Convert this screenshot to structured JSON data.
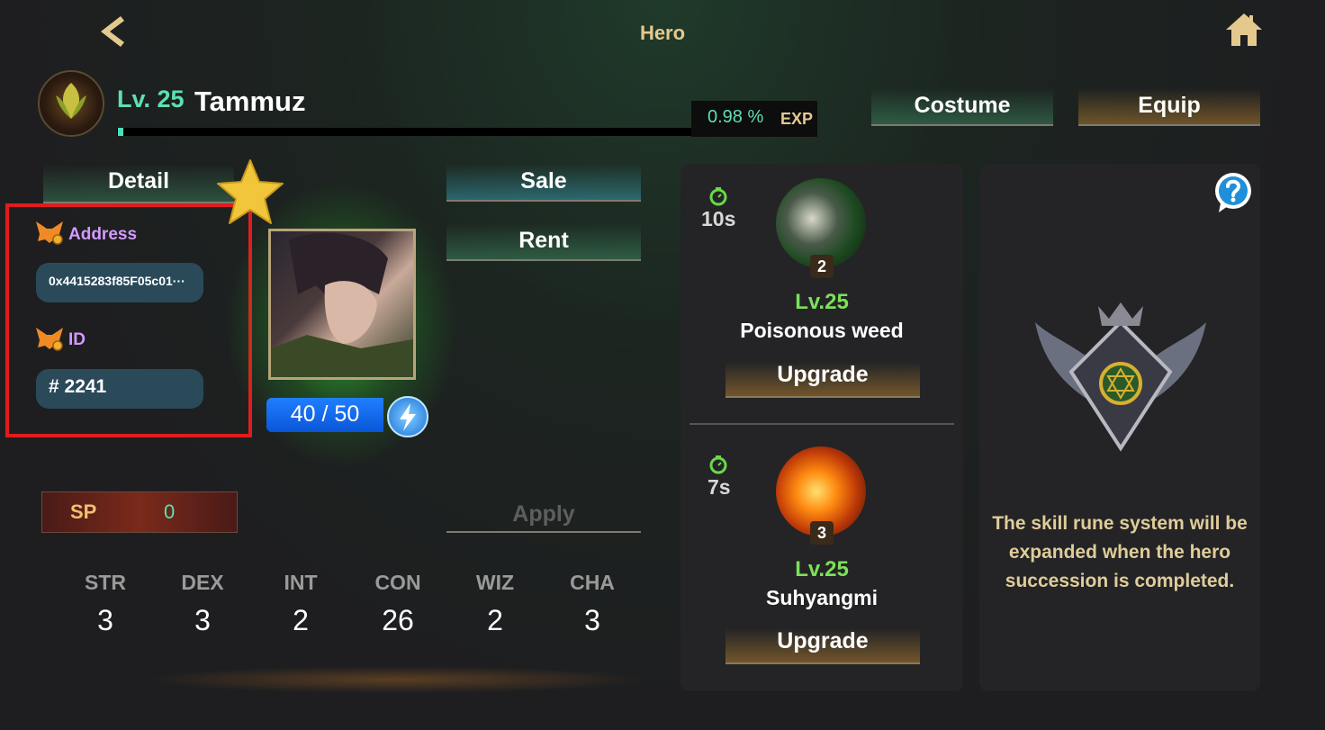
{
  "header": {
    "title": "Hero"
  },
  "hero": {
    "level": "Lv. 25",
    "name": "Tammuz",
    "exp_percent": "0.98 %",
    "exp_label": "EXP",
    "exp_fraction": 0.0098
  },
  "nav": {
    "costume_label": "Costume",
    "equip_label": "Equip",
    "detail_label": "Detail",
    "sale_label": "Sale",
    "rent_label": "Rent",
    "apply_label": "Apply"
  },
  "info": {
    "address_label": "Address",
    "address_value": "0x4415283f85F05c01···",
    "id_label": "ID",
    "id_value": "# 2241"
  },
  "stamina": {
    "value": "40 / 50"
  },
  "sp": {
    "label": "SP",
    "value": "0"
  },
  "stats": [
    {
      "name": "STR",
      "value": "3"
    },
    {
      "name": "DEX",
      "value": "3"
    },
    {
      "name": "INT",
      "value": "2"
    },
    {
      "name": "CON",
      "value": "26"
    },
    {
      "name": "WIZ",
      "value": "2"
    },
    {
      "name": "CHA",
      "value": "3"
    }
  ],
  "skills": [
    {
      "cooldown": "10s",
      "badge": "2",
      "level": "Lv.25",
      "name": "Poisonous weed",
      "upgrade_label": "Upgrade"
    },
    {
      "cooldown": "7s",
      "badge": "3",
      "level": "Lv.25",
      "name": "Suhyangmi",
      "upgrade_label": "Upgrade"
    }
  ],
  "rune": {
    "message": "The skill rune system will be expanded when the hero succession is completed."
  },
  "colors": {
    "accent_gold": "#e4c98f",
    "accent_teal": "#5de0b0",
    "label_purple": "#d49aff",
    "highlight_red": "#e01c1c"
  }
}
